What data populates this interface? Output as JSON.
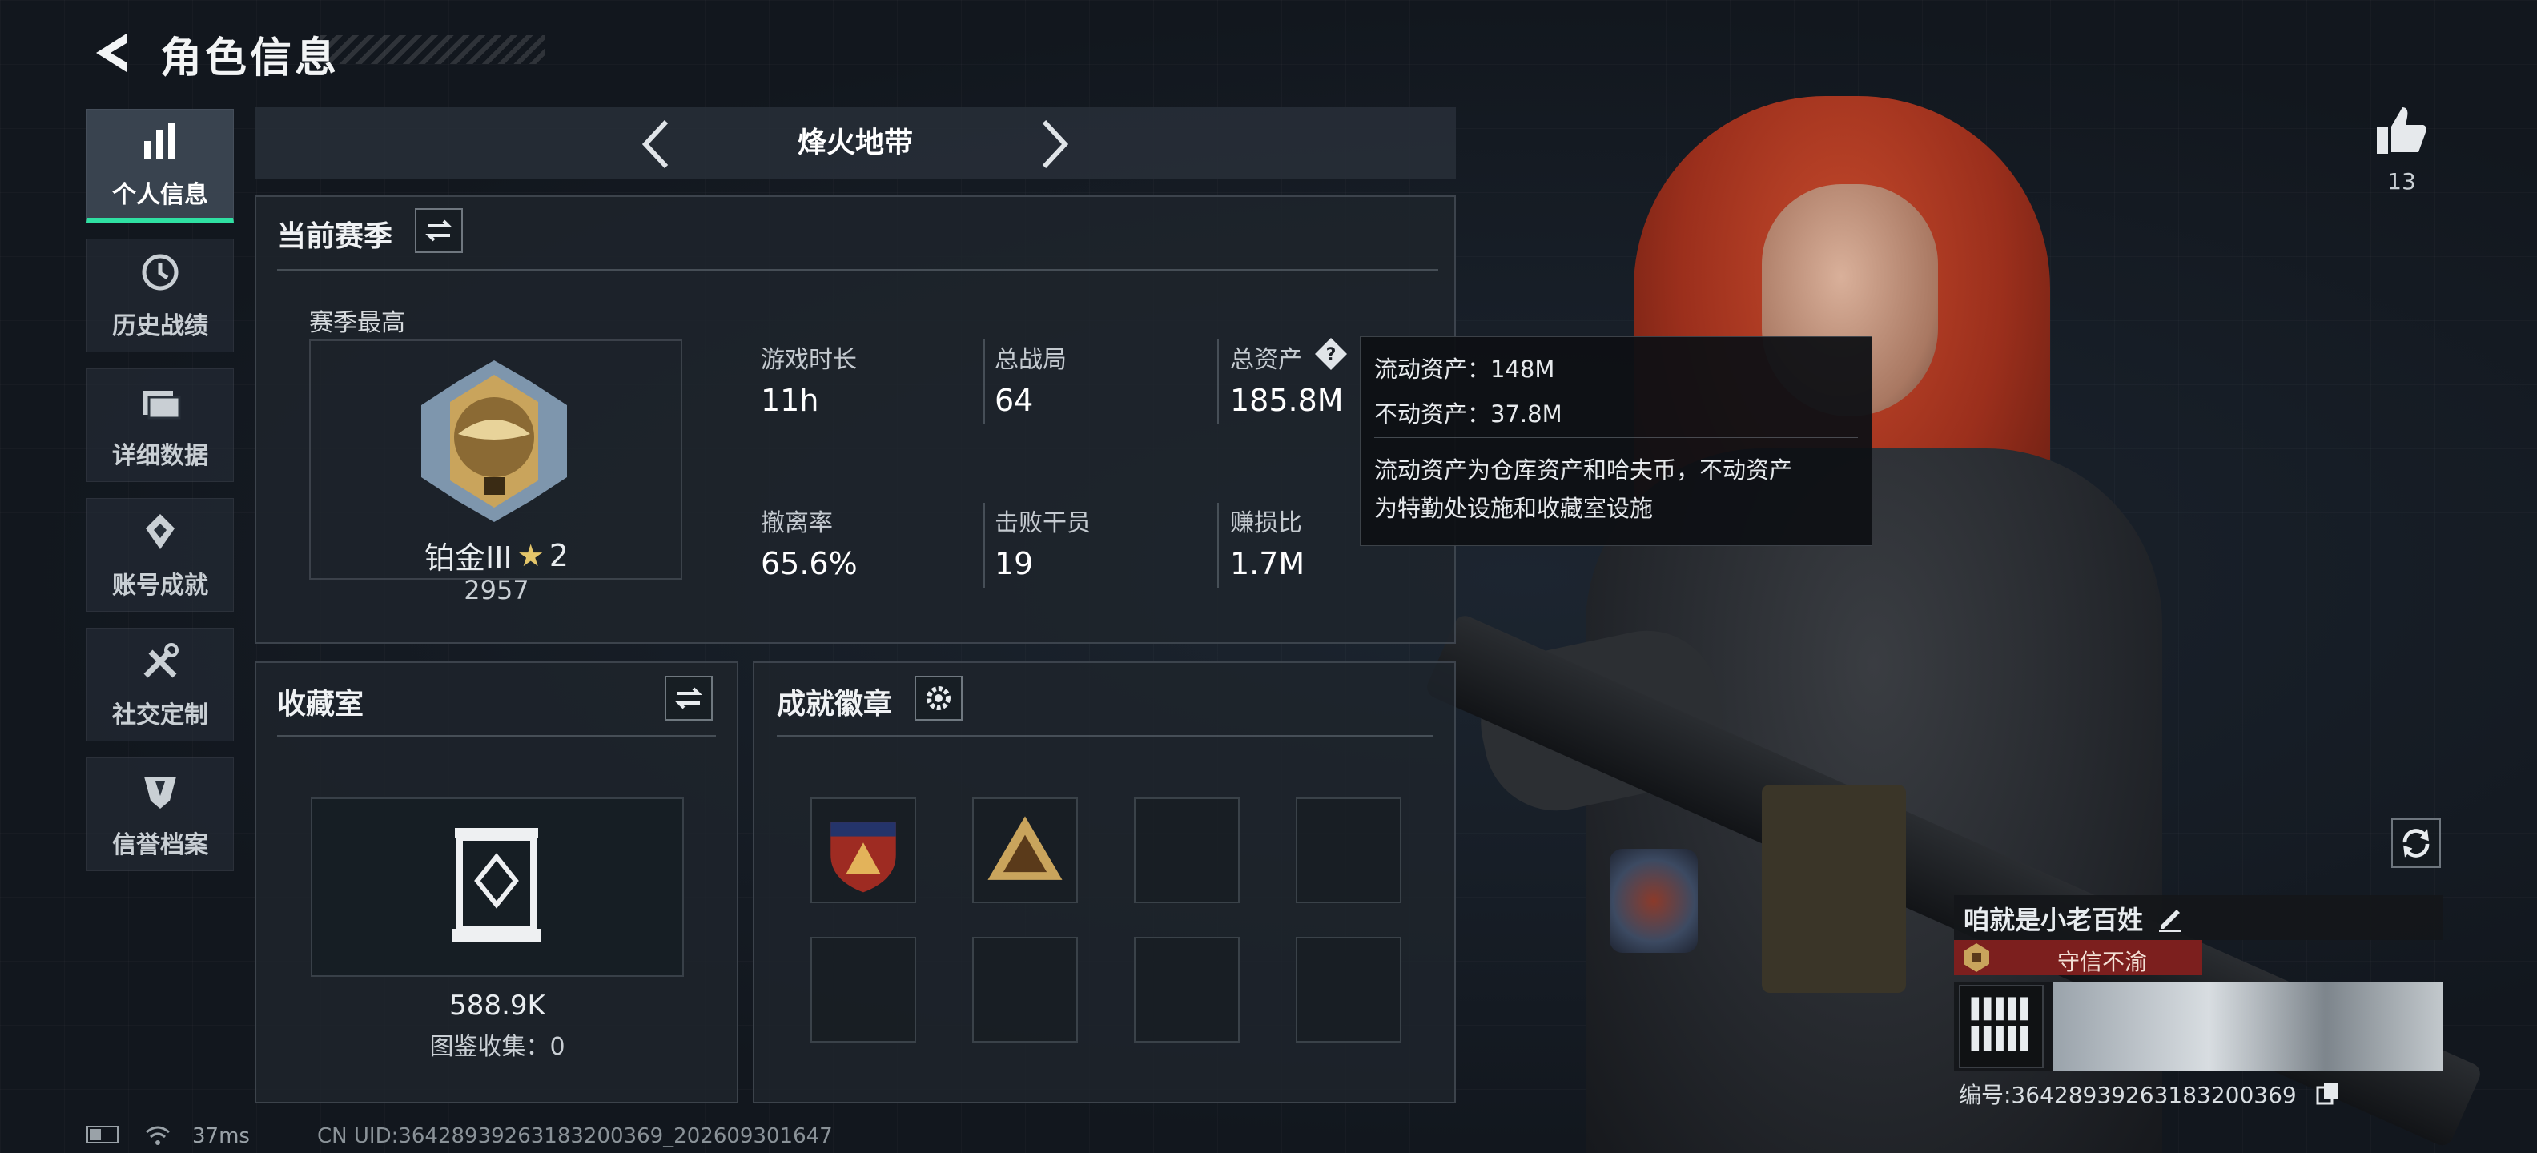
{
  "header": {
    "title": "角色信息"
  },
  "sidebar": {
    "items": [
      {
        "label": "个人信息",
        "icon": "bar-chart-icon",
        "active": true
      },
      {
        "label": "历史战绩",
        "icon": "history-icon"
      },
      {
        "label": "详细数据",
        "icon": "folder-icon"
      },
      {
        "label": "账号成就",
        "icon": "achievement-icon"
      },
      {
        "label": "社交定制",
        "icon": "tools-icon"
      },
      {
        "label": "信誉档案",
        "icon": "shield-icon"
      }
    ]
  },
  "mode_switch": {
    "name": "烽火地带"
  },
  "season_panel": {
    "title": "当前赛季",
    "season_high_label": "赛季最高",
    "rank_name": "铂金III",
    "rank_stars": "2",
    "rank_score": "2957",
    "stats": [
      {
        "label": "游戏时长",
        "value": "11h"
      },
      {
        "label": "总战局",
        "value": "64"
      },
      {
        "label": "总资产",
        "value": "185.8M"
      },
      {
        "label": "撤离率",
        "value": "65.6%"
      },
      {
        "label": "击败干员",
        "value": "19"
      },
      {
        "label": "赚损比",
        "value": "1.7M"
      }
    ]
  },
  "tooltip": {
    "liquid": "流动资产：148M",
    "fixed": "不动资产：37.8M",
    "desc_line1": "流动资产为仓库资产和哈夫币，不动资产",
    "desc_line2": "为特勤处设施和收藏室设施"
  },
  "collection_panel": {
    "title": "收藏室",
    "value": "588.9K",
    "collection_label": "图鉴收集：0"
  },
  "badge_panel": {
    "title": "成就徽章"
  },
  "likes": {
    "count": "13"
  },
  "profile": {
    "name": "咱就是小老百姓",
    "badge_text": "守信不渝",
    "id_text": "编号:3642893926318320​0369"
  },
  "status_bar": {
    "ping": "37ms",
    "uid": "CN UID:3642893926318320​0369_202609301647"
  },
  "colors": {
    "accent": "#2fe0a2",
    "badge_red": "#7c1f1e",
    "rank_gold": "#c9a45c"
  }
}
